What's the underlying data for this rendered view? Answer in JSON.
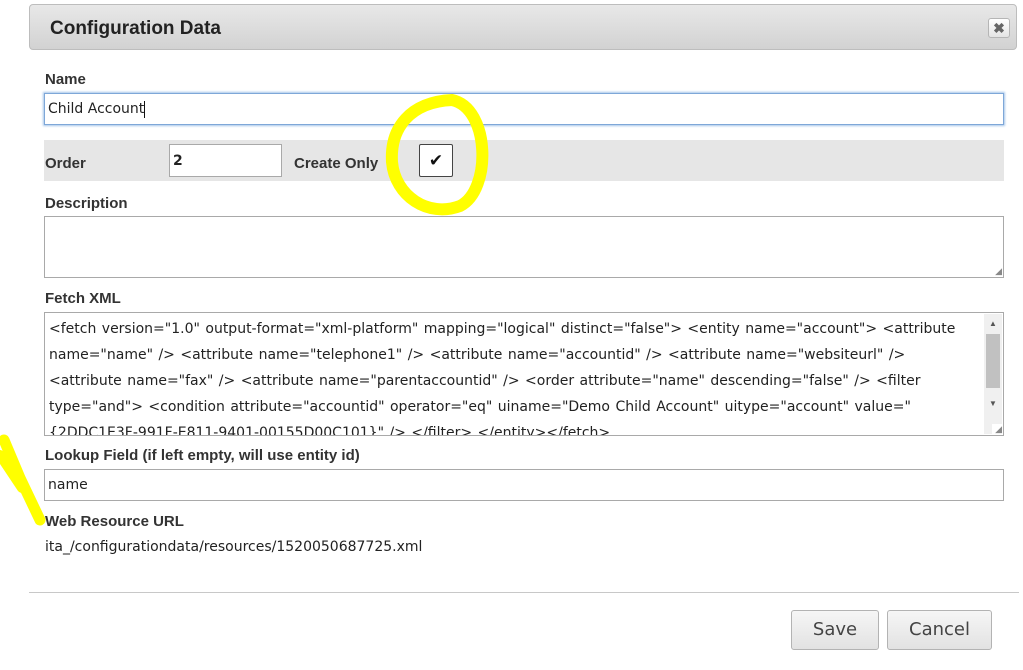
{
  "dialog": {
    "title": "Configuration Data",
    "close_glyph": "✖"
  },
  "fields": {
    "name_label": "Name",
    "name_value": "Child Account",
    "order_label": "Order",
    "order_value": "2",
    "create_only_label": "Create Only",
    "create_only_checked": true,
    "create_only_glyph": "✔",
    "description_label": "Description",
    "description_value": "",
    "fetch_xml_label": "Fetch XML",
    "fetch_xml_value": "<fetch version=\"1.0\" output-format=\"xml-platform\" mapping=\"logical\" distinct=\"false\">  <entity name=\"account\">     <attribute name=\"name\" />     <attribute name=\"telephone1\" />     <attribute name=\"accountid\" />     <attribute name=\"websiteurl\" />     <attribute name=\"fax\" />     <attribute name=\"parentaccountid\" />     <order attribute=\"name\" descending=\"false\" />     <filter type=\"and\">       <condition attribute=\"accountid\" operator=\"eq\" uiname=\"Demo Child Account\" uitype=\"account\" value=\"{2DDC1E3F-991F-E811-9401-00155D00C101}\" />     </filter>   </entity></fetch>",
    "lookup_label": "Lookup Field (if left empty, will use entity id)",
    "lookup_value": "name",
    "web_resource_label": "Web Resource URL",
    "web_resource_value": "ita_/configurationdata/resources/1520050687725.xml"
  },
  "buttons": {
    "save": "Save",
    "cancel": "Cancel"
  },
  "icons": {
    "close": "close-icon",
    "checkmark": "checkmark-icon",
    "scroll_up": "scroll-up-icon",
    "scroll_down": "scroll-down-icon",
    "resize_grip": "resize-grip-icon"
  },
  "colors": {
    "annotation_highlight": "#ffff00",
    "focus_border": "#7ea7d8",
    "order_row_bg": "#e6e6e6"
  }
}
